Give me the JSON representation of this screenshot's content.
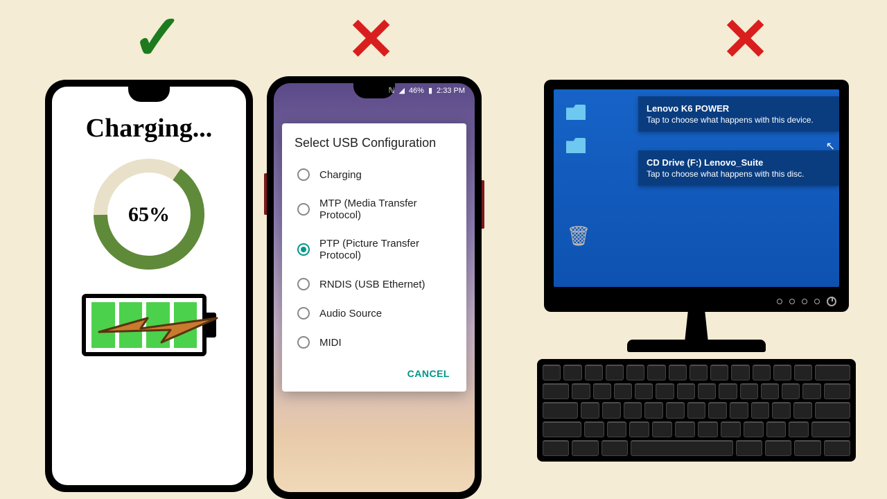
{
  "marks": {
    "check": "✓",
    "cross": "✕"
  },
  "phone1": {
    "title": "Charging...",
    "percent": "65%",
    "progress": 65
  },
  "phone2": {
    "status": {
      "signal": "📶",
      "battery": "46%",
      "time": "2:33 PM"
    },
    "dialog": {
      "title": "Select USB Configuration",
      "options": [
        {
          "label": "Charging",
          "selected": false
        },
        {
          "label": "MTP (Media Transfer Protocol)",
          "selected": false
        },
        {
          "label": "PTP (Picture Transfer Protocol)",
          "selected": true
        },
        {
          "label": "RNDIS (USB Ethernet)",
          "selected": false
        },
        {
          "label": "Audio Source",
          "selected": false
        },
        {
          "label": "MIDI",
          "selected": false
        }
      ],
      "cancel": "CANCEL"
    }
  },
  "monitor": {
    "toasts": [
      {
        "title": "Lenovo K6 POWER",
        "body": "Tap to choose what happens with this device."
      },
      {
        "title": "CD Drive (F:) Lenovo_Suite",
        "body": "Tap to choose what happens with this disc."
      }
    ]
  }
}
